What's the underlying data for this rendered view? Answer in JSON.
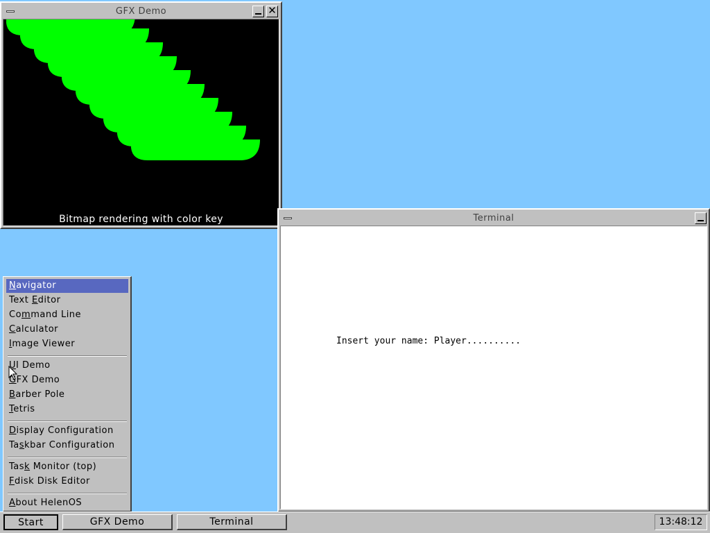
{
  "colors": {
    "desktop": "#80c8ff",
    "window_face": "#c0c0c0",
    "gfx_background": "#000000",
    "gfx_shape": "#00ff00",
    "menu_selection": "#5868c0",
    "terminal_background": "#ffffff"
  },
  "gfx_window": {
    "title": "GFX Demo",
    "caption": "Bitmap rendering with color key",
    "icons": [
      "window-menu-icon",
      "minimize-icon",
      "close-icon"
    ]
  },
  "terminal_window": {
    "title": "Terminal",
    "line": "Insert your name: Player..........",
    "icons": [
      "window-menu-icon",
      "minimize-icon"
    ]
  },
  "start_menu": {
    "items": [
      {
        "pre": "",
        "key": "N",
        "post": "avigator",
        "selected": true
      },
      {
        "pre": "Text ",
        "key": "E",
        "post": "ditor"
      },
      {
        "pre": "Co",
        "key": "m",
        "post": "mand Line"
      },
      {
        "pre": "",
        "key": "C",
        "post": "alculator"
      },
      {
        "pre": "",
        "key": "I",
        "post": "mage Viewer"
      },
      {
        "pre": "",
        "key": "U",
        "post": "I Demo"
      },
      {
        "pre": "",
        "key": "G",
        "post": "FX Demo"
      },
      {
        "pre": "",
        "key": "B",
        "post": "arber Pole"
      },
      {
        "pre": "",
        "key": "T",
        "post": "etris"
      },
      {
        "pre": "",
        "key": "D",
        "post": "isplay Configuration"
      },
      {
        "pre": "Ta",
        "key": "s",
        "post": "kbar Configuration"
      },
      {
        "pre": "Tas",
        "key": "k",
        "post": " Monitor (top)"
      },
      {
        "pre": "",
        "key": "F",
        "post": "disk Disk Editor"
      },
      {
        "pre": "",
        "key": "A",
        "post": "bout HelenOS"
      }
    ]
  },
  "taskbar": {
    "start_label": "Start",
    "buttons": [
      "GFX Demo",
      "Terminal"
    ],
    "clock": "13:48:12"
  }
}
